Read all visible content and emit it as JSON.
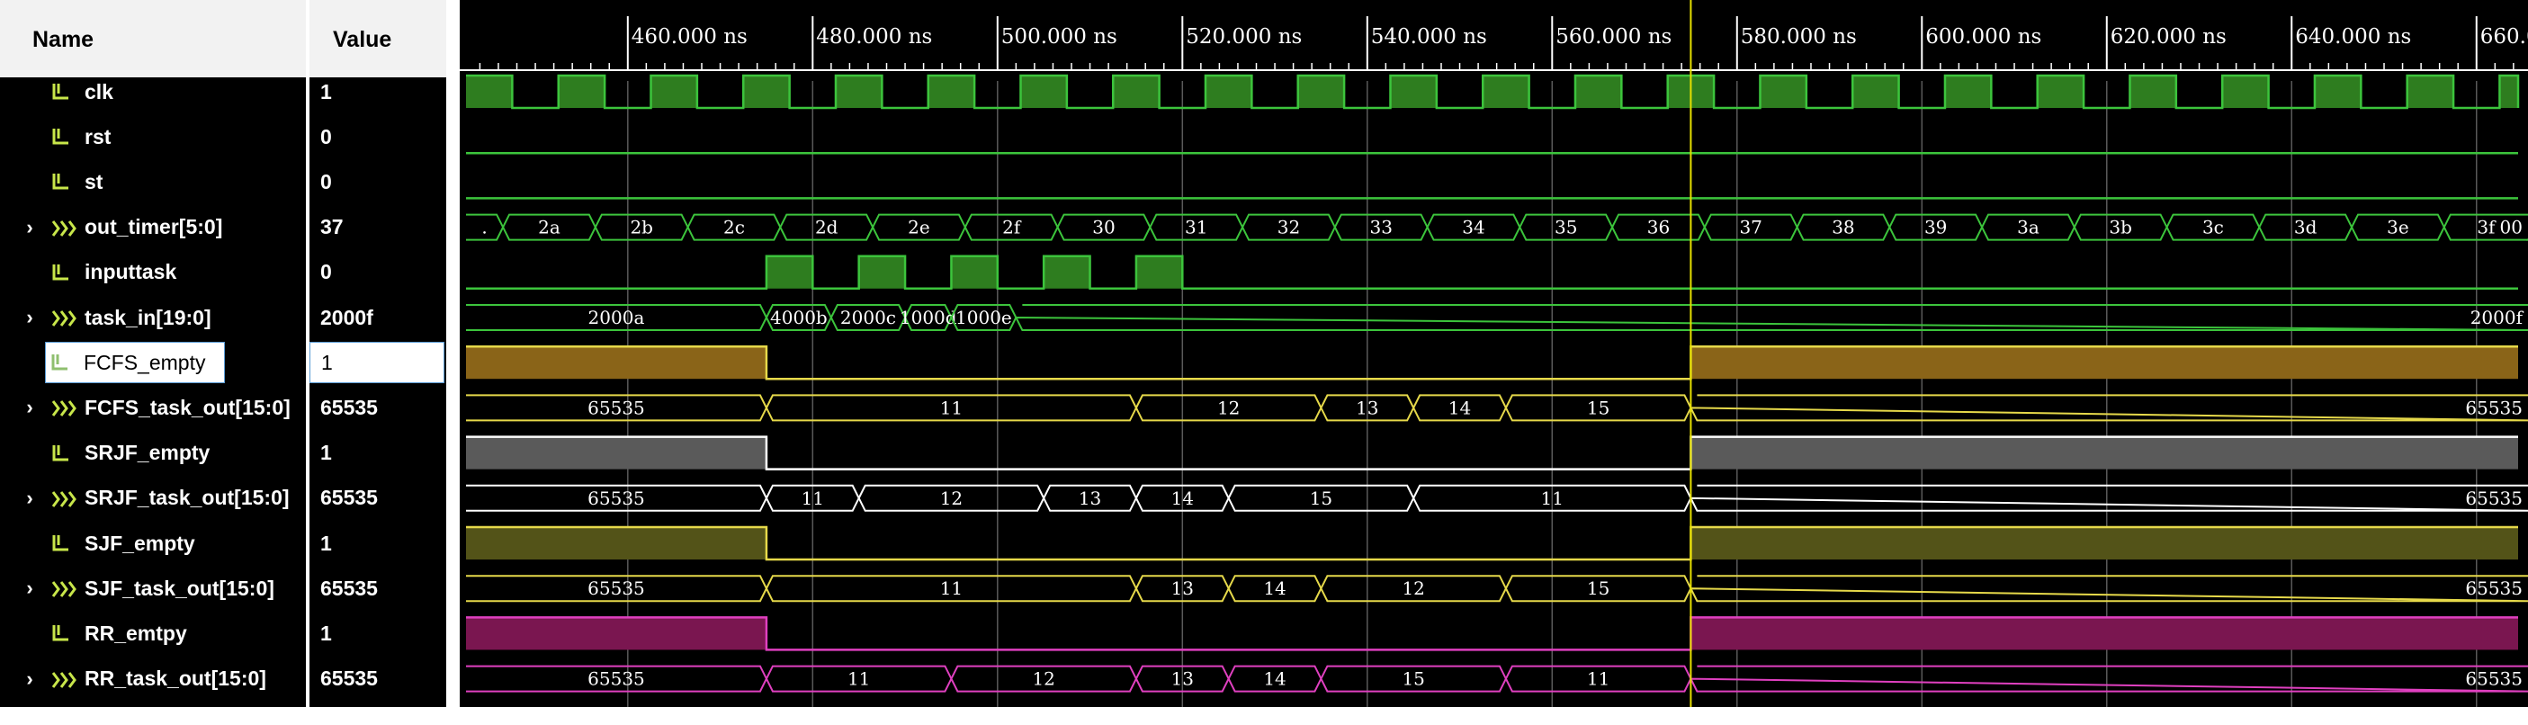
{
  "header": {
    "name_label": "Name",
    "value_label": "Value"
  },
  "time_axis": {
    "start_ns": 442.5,
    "end_ns": 664.5,
    "unit": "ns",
    "major_ticks": [
      "460.000 ns",
      "480.000 ns",
      "500.000 ns",
      "520.000 ns",
      "540.000 ns",
      "560.000 ns",
      "580.000 ns",
      "600.000 ns",
      "620.000 ns",
      "640.000 ns",
      "660.000 ns"
    ],
    "cursor_ns": 575
  },
  "colors": {
    "clk": "#3cc43c",
    "clk_fill": "#2e7d1f",
    "yellow": "#e6d94a",
    "fcfs_fill": "#8a6418",
    "srjf_line": "#ffffff",
    "srjf_fill": "#5a5a5a",
    "sjf_fill": "#535318",
    "rr_line": "#e040c0",
    "rr_fill": "#7a1650",
    "cursor": "#e6e000",
    "grid": "#5a5a5a"
  },
  "signals": [
    {
      "id": "clk",
      "name": "clk",
      "value": "1",
      "type": "bit",
      "icon": "signal-bit-icon",
      "expandable": false,
      "color": "clk",
      "wave": "clock",
      "clock_period_ns": 10,
      "clock_high_start_ns": 442.5
    },
    {
      "id": "rst",
      "name": "rst",
      "value": "0",
      "type": "bit",
      "icon": "signal-bit-icon",
      "expandable": false,
      "color": "clk",
      "wave": "bit",
      "segments": [
        [
          442.5,
          664.5,
          0
        ]
      ]
    },
    {
      "id": "st",
      "name": "st",
      "value": "0",
      "type": "bit",
      "icon": "signal-bit-icon",
      "expandable": false,
      "color": "clk",
      "wave": "bit",
      "segments": [
        [
          442.5,
          664.5,
          0
        ]
      ]
    },
    {
      "id": "out_timer",
      "name": "out_timer[5:0]",
      "value": "37",
      "type": "bus",
      "icon": "signal-bus-icon",
      "expandable": true,
      "color": "clk",
      "wave": "bus",
      "segments": [
        [
          442.5,
          446.5,
          "."
        ],
        [
          446.5,
          456.5,
          "2a"
        ],
        [
          456.5,
          466.5,
          "2b"
        ],
        [
          466.5,
          476.5,
          "2c"
        ],
        [
          476.5,
          486.5,
          "2d"
        ],
        [
          486.5,
          496.5,
          "2e"
        ],
        [
          496.5,
          506.5,
          "2f"
        ],
        [
          506.5,
          516.5,
          "30"
        ],
        [
          516.5,
          526.5,
          "31"
        ],
        [
          526.5,
          536.5,
          "32"
        ],
        [
          536.5,
          546.5,
          "33"
        ],
        [
          546.5,
          556.5,
          "34"
        ],
        [
          556.5,
          566.5,
          "35"
        ],
        [
          566.5,
          576.5,
          "36"
        ],
        [
          576.5,
          586.5,
          "37"
        ],
        [
          586.5,
          596.5,
          "38"
        ],
        [
          596.5,
          606.5,
          "39"
        ],
        [
          606.5,
          616.5,
          "3a"
        ],
        [
          616.5,
          626.5,
          "3b"
        ],
        [
          626.5,
          636.5,
          "3c"
        ],
        [
          636.5,
          646.5,
          "3d"
        ],
        [
          646.5,
          656.5,
          "3e"
        ],
        [
          656.5,
          666.5,
          "3f"
        ],
        [
          666.5,
          676.5,
          "00"
        ]
      ]
    },
    {
      "id": "inputtask",
      "name": "inputtask",
      "value": "0",
      "type": "bit",
      "icon": "signal-bit-icon",
      "expandable": false,
      "color": "clk",
      "wave": "bit",
      "segments": [
        [
          442.5,
          475,
          0
        ],
        [
          475,
          480,
          1
        ],
        [
          480,
          485,
          0
        ],
        [
          485,
          490,
          1
        ],
        [
          490,
          495,
          0
        ],
        [
          495,
          500,
          1
        ],
        [
          500,
          505,
          0
        ],
        [
          505,
          510,
          1
        ],
        [
          510,
          515,
          0
        ],
        [
          515,
          520,
          1
        ],
        [
          520,
          664.5,
          0
        ]
      ]
    },
    {
      "id": "task_in",
      "name": "task_in[19:0]",
      "value": "2000f",
      "type": "bus",
      "icon": "signal-bus-icon",
      "expandable": true,
      "color": "clk",
      "wave": "bus",
      "segments": [
        [
          442.5,
          475,
          "2000a"
        ],
        [
          475,
          482,
          "4000b"
        ],
        [
          482,
          490,
          "2000c"
        ],
        [
          490,
          495,
          "1000d"
        ],
        [
          495,
          502,
          "1000e"
        ],
        [
          502,
          666,
          "2000f"
        ]
      ]
    },
    {
      "id": "fcfs_empty",
      "name": "FCFS_empty",
      "value": "1",
      "type": "bit",
      "icon": "signal-bit-icon",
      "expandable": false,
      "color": "yellow",
      "fill": "fcfs_fill",
      "selected": true,
      "wave": "bit",
      "segments": [
        [
          442.5,
          475,
          1
        ],
        [
          475,
          575,
          0
        ],
        [
          575,
          664.5,
          1
        ]
      ]
    },
    {
      "id": "fcfs_task_out",
      "name": "FCFS_task_out[15:0]",
      "value": "65535",
      "type": "bus",
      "icon": "signal-bus-icon",
      "expandable": true,
      "color": "yellow",
      "wave": "bus",
      "segments": [
        [
          442.5,
          475,
          "65535"
        ],
        [
          475,
          515,
          "11"
        ],
        [
          515,
          535,
          "12"
        ],
        [
          535,
          545,
          "13"
        ],
        [
          545,
          555,
          "14"
        ],
        [
          555,
          575,
          "15"
        ],
        [
          575,
          666,
          "65535"
        ]
      ]
    },
    {
      "id": "srjf_empty",
      "name": "SRJF_empty",
      "value": "1",
      "type": "bit",
      "icon": "signal-bit-icon",
      "expandable": false,
      "color": "srjf_line",
      "fill": "srjf_fill",
      "wave": "bit",
      "segments": [
        [
          442.5,
          475,
          1
        ],
        [
          475,
          575,
          0
        ],
        [
          575,
          664.5,
          1
        ]
      ]
    },
    {
      "id": "srjf_task_out",
      "name": "SRJF_task_out[15:0]",
      "value": "65535",
      "type": "bus",
      "icon": "signal-bus-icon",
      "expandable": true,
      "color": "srjf_line",
      "wave": "bus",
      "segments": [
        [
          442.5,
          475,
          "65535"
        ],
        [
          475,
          485,
          "11"
        ],
        [
          485,
          505,
          "12"
        ],
        [
          505,
          515,
          "13"
        ],
        [
          515,
          525,
          "14"
        ],
        [
          525,
          545,
          "15"
        ],
        [
          545,
          575,
          "11"
        ],
        [
          575,
          666,
          "65535"
        ]
      ]
    },
    {
      "id": "sjf_empty",
      "name": "SJF_empty",
      "value": "1",
      "type": "bit",
      "icon": "signal-bit-icon",
      "expandable": false,
      "color": "yellow",
      "fill": "sjf_fill",
      "wave": "bit",
      "segments": [
        [
          442.5,
          475,
          1
        ],
        [
          475,
          575,
          0
        ],
        [
          575,
          664.5,
          1
        ]
      ]
    },
    {
      "id": "sjf_task_out",
      "name": "SJF_task_out[15:0]",
      "value": "65535",
      "type": "bus",
      "icon": "signal-bus-icon",
      "expandable": true,
      "color": "yellow",
      "wave": "bus",
      "segments": [
        [
          442.5,
          475,
          "65535"
        ],
        [
          475,
          515,
          "11"
        ],
        [
          515,
          525,
          "13"
        ],
        [
          525,
          535,
          "14"
        ],
        [
          535,
          555,
          "12"
        ],
        [
          555,
          575,
          "15"
        ],
        [
          575,
          666,
          "65535"
        ]
      ]
    },
    {
      "id": "rr_emtpy",
      "name": "RR_emtpy",
      "value": "1",
      "type": "bit",
      "icon": "signal-bit-icon",
      "expandable": false,
      "color": "rr_line",
      "fill": "rr_fill",
      "wave": "bit",
      "segments": [
        [
          442.5,
          475,
          1
        ],
        [
          475,
          575,
          0
        ],
        [
          575,
          664.5,
          1
        ]
      ]
    },
    {
      "id": "rr_task_out",
      "name": "RR_task_out[15:0]",
      "value": "65535",
      "type": "bus",
      "icon": "signal-bus-icon",
      "expandable": true,
      "color": "rr_line",
      "wave": "bus",
      "segments": [
        [
          442.5,
          475,
          "65535"
        ],
        [
          475,
          495,
          "11"
        ],
        [
          495,
          515,
          "12"
        ],
        [
          515,
          525,
          "13"
        ],
        [
          525,
          535,
          "14"
        ],
        [
          535,
          555,
          "15"
        ],
        [
          555,
          575,
          "11"
        ],
        [
          575,
          666,
          "65535"
        ]
      ]
    }
  ]
}
